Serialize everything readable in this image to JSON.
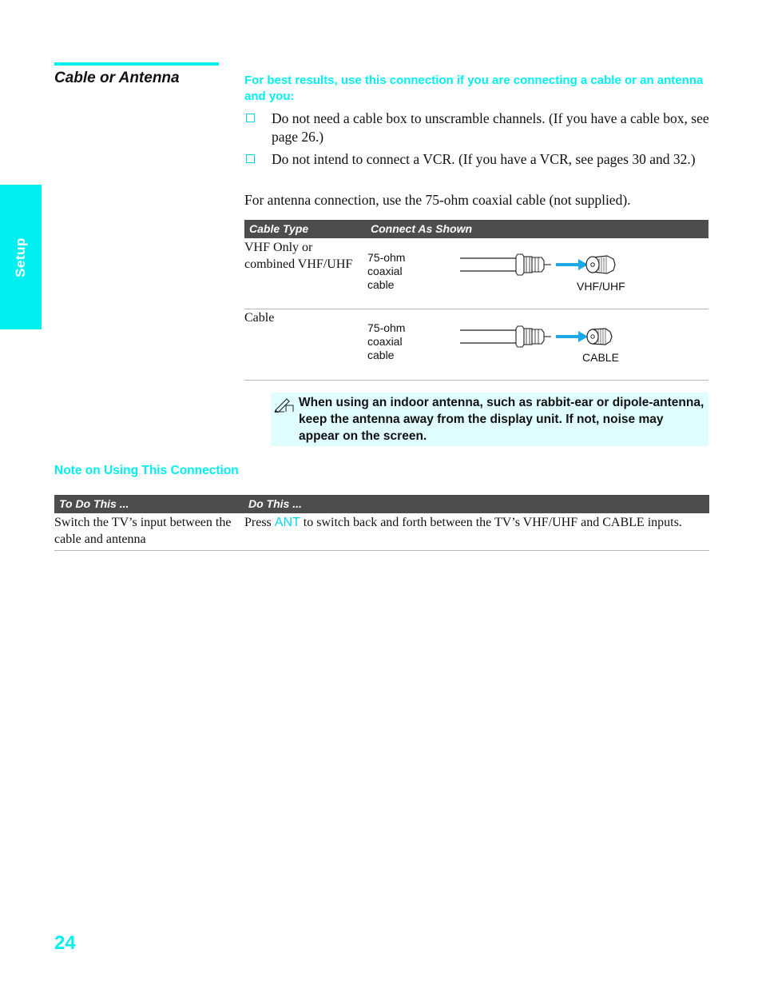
{
  "side_tab": {
    "label": "Setup"
  },
  "section": {
    "title": "Cable or Antenna"
  },
  "intro": "For best results, use this connection if you are connecting a cable or an antenna and you:",
  "bullets": [
    "Do not need a cable box to unscramble channels. (If you have a cable box, see page 26.)",
    "Do not intend to connect a VCR. (If you have a VCR, see pages 30 and 32.)"
  ],
  "antenna_note": "For antenna connection, use the 75-ohm coaxial cable (not supplied).",
  "connection_table": {
    "headers": [
      "Cable Type",
      "Connect As Shown"
    ],
    "rows": [
      {
        "type": "VHF Only or combined VHF/UHF",
        "cable_label": "75-ohm coaxial cable",
        "port": "VHF/UHF"
      },
      {
        "type": "Cable",
        "cable_label": "75-ohm coaxial cable",
        "port": "CABLE"
      }
    ]
  },
  "tip": {
    "icon": "pencil-note-icon",
    "text": "When using an indoor antenna, such as rabbit-ear or dipole-antenna, keep the antenna away from the display unit. If not, noise may appear on the screen."
  },
  "note_heading": "Note on Using This Connection",
  "note_table": {
    "headers": [
      "To Do This ...",
      "Do This ..."
    ],
    "rows": [
      {
        "todo": "Switch the TV’s input between the cable and antenna",
        "do_prefix": "Press ",
        "do_key": "ANT",
        "do_suffix": " to switch back and forth between the TV’s VHF/UHF and CABLE inputs."
      }
    ]
  },
  "colors": {
    "accent": "#00f0f0",
    "header_bg": "#4d4d4d",
    "tip_bg": "#e0fdff",
    "arrow": "#1aa8e8"
  },
  "page_number": "24"
}
